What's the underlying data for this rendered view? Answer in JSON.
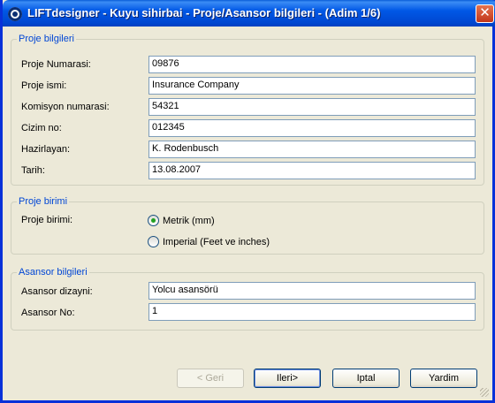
{
  "window": {
    "title": "LIFTdesigner - Kuyu sihirbai - Proje/Asansor bilgileri - (Adim 1/6)",
    "close_glyph": "✕"
  },
  "proje_bilgileri": {
    "legend": "Proje bilgileri",
    "fields": [
      {
        "label": "Proje Numarasi:",
        "value": "09876"
      },
      {
        "label": "Proje ismi:",
        "value": "Insurance Company"
      },
      {
        "label": "Komisyon numarasi:",
        "value": "54321"
      },
      {
        "label": "Cizim no:",
        "value": "012345"
      },
      {
        "label": "Hazirlayan:",
        "value": "K. Rodenbusch"
      },
      {
        "label": "Tarih:",
        "value": "13.08.2007"
      }
    ]
  },
  "proje_birimi": {
    "legend": "Proje birimi",
    "label": "Proje birimi:",
    "options": [
      {
        "label": "Metrik (mm)",
        "selected": true
      },
      {
        "label": "Imperial (Feet ve inches)",
        "selected": false
      }
    ]
  },
  "asansor_bilgileri": {
    "legend": "Asansor bilgileri",
    "fields": [
      {
        "label": "Asansor dizayni:",
        "value": "Yolcu asansörü"
      },
      {
        "label": "Asansor No:",
        "value": "1"
      }
    ]
  },
  "buttons": {
    "back": "< Geri",
    "next": "Ileri>",
    "cancel": "Iptal",
    "help": "Yardim"
  }
}
